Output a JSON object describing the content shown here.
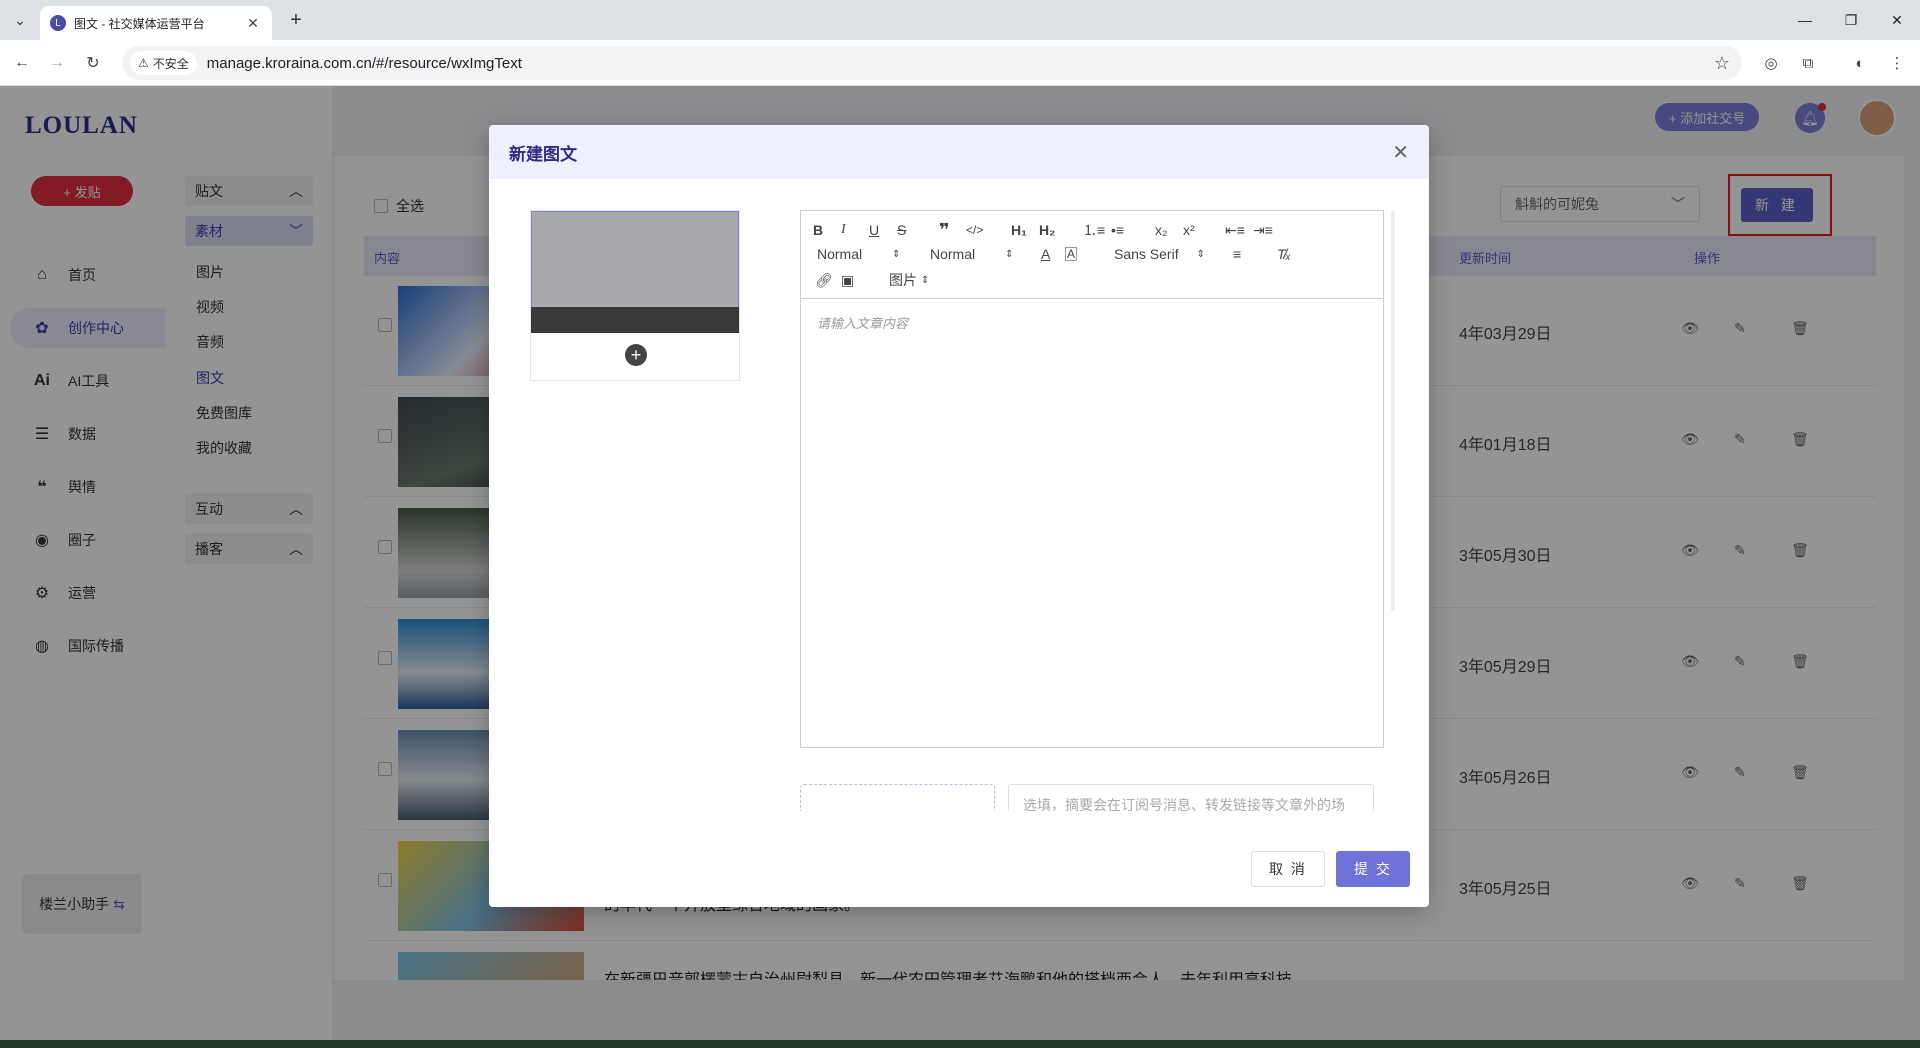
{
  "browser": {
    "tab_title": "图文 - 社交媒体运营平台",
    "security_label": "不安全",
    "url": "manage.kroraina.com.cn/#/resource/wxImgText"
  },
  "sidebar": {
    "logo": "LOULAN",
    "post_button": "+ 发贴",
    "items": [
      {
        "label": "首页",
        "icon": "home-icon"
      },
      {
        "label": "创作中心",
        "icon": "palette-icon"
      },
      {
        "label": "AI工具",
        "icon": "ai-icon"
      },
      {
        "label": "数据",
        "icon": "database-icon"
      },
      {
        "label": "舆情",
        "icon": "quote-icon"
      },
      {
        "label": "圈子",
        "icon": "compass-icon"
      },
      {
        "label": "运营",
        "icon": "operation-icon"
      },
      {
        "label": "国际传播",
        "icon": "globe-icon"
      }
    ],
    "assistant": "楼兰小助手"
  },
  "subnav": {
    "groups": [
      "贴文",
      "素材",
      "互动",
      "播客"
    ],
    "material_items": [
      "图片",
      "视频",
      "音频",
      "图文",
      "免费图库",
      "我的收藏"
    ]
  },
  "header": {
    "add_social": "+ 添加社交号"
  },
  "content": {
    "select_all": "全选",
    "account_select": "斛斛的可妮兔",
    "new_button": "新 建",
    "columns": {
      "content": "内容",
      "updated": "更新时间",
      "actions": "操作"
    },
    "rows": [
      {
        "date": "4年03月29日",
        "title": ""
      },
      {
        "date": "4年01月18日",
        "title": ""
      },
      {
        "date": "3年05月30日",
        "title": ""
      },
      {
        "date": "3年05月29日",
        "title": ""
      },
      {
        "date": "3年05月26日",
        "title": ""
      },
      {
        "date": "3年05月25日",
        "title": "的早代一个开放型综合地域的画家。"
      },
      {
        "date": "",
        "title": "在新疆巴音郭楞蒙古自治州尉犁县，新一代农田管理者艾海鹏和他的搭档西会人，去年利用高科技"
      }
    ]
  },
  "modal": {
    "title": "新建图文",
    "toolbar": {
      "header_select": "Normal",
      "size_select": "Normal",
      "font_select": "Sans Serif",
      "image_select": "图片"
    },
    "editor_placeholder": "请输入文章内容",
    "summary_placeholder": "选填，摘要会在订阅号消息、转发链接等文章外的场",
    "cancel": "取 消",
    "submit": "提 交"
  }
}
